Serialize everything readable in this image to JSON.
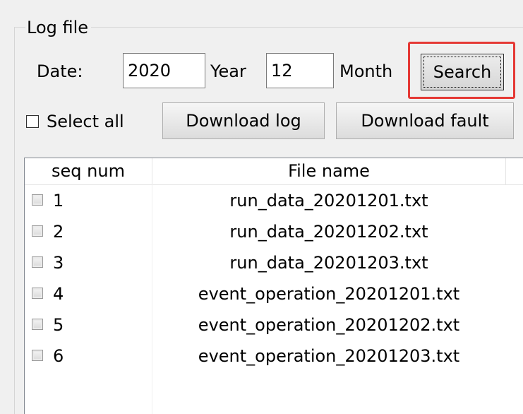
{
  "group_title": "Log file",
  "date_label": "Date:",
  "year_value": "2020",
  "year_label": "Year",
  "month_value": "12",
  "month_label": "Month",
  "search_label": "Search",
  "select_all_label": "Select all",
  "download_log_label": "Download log",
  "download_fault_label": "Download fault",
  "table": {
    "columns": [
      "seq num",
      "File name"
    ],
    "rows": [
      {
        "seq": "1",
        "file": "run_data_20201201.txt",
        "checked": false
      },
      {
        "seq": "2",
        "file": "run_data_20201202.txt",
        "checked": false
      },
      {
        "seq": "3",
        "file": "run_data_20201203.txt",
        "checked": false
      },
      {
        "seq": "4",
        "file": "event_operation_20201201.txt",
        "checked": false
      },
      {
        "seq": "5",
        "file": "event_operation_20201202.txt",
        "checked": false
      },
      {
        "seq": "6",
        "file": "event_operation_20201203.txt",
        "checked": false
      }
    ]
  },
  "colors": {
    "highlight": "#e53935",
    "window_bg": "#f0f0f0"
  }
}
